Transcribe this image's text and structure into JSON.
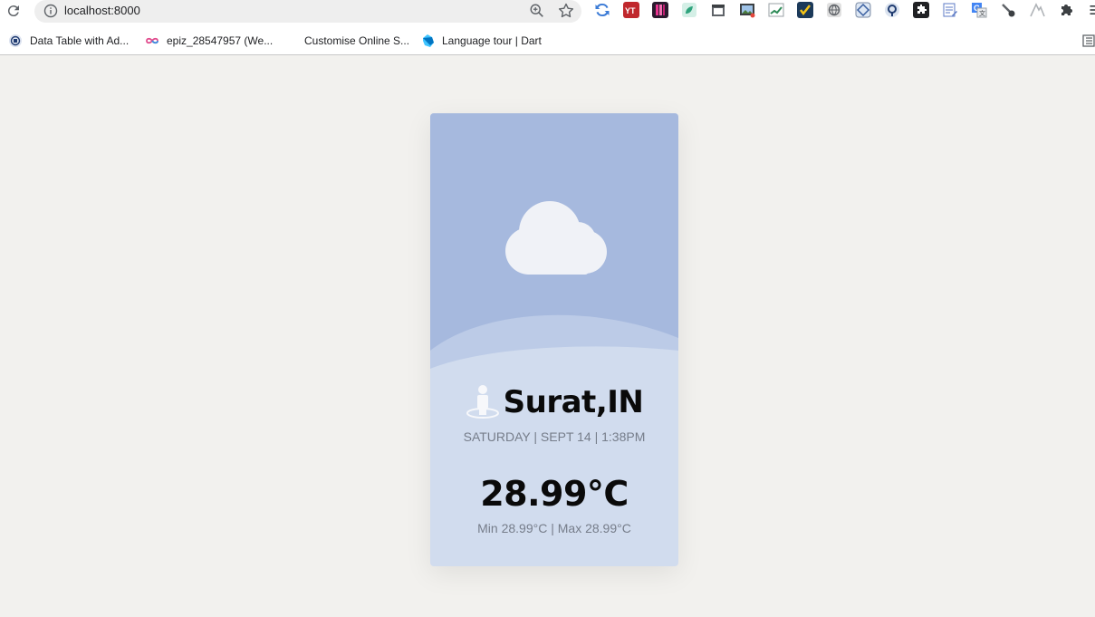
{
  "browser": {
    "url": "localhost:8000",
    "bookmarks": [
      {
        "label": "Data Table with Ad...",
        "icon": "datatables-icon"
      },
      {
        "label": "epiz_28547957 (We...",
        "icon": "infinity-icon"
      },
      {
        "label": "Customise Online S...",
        "icon": "blank-icon"
      },
      {
        "label": "Language tour | Dart",
        "icon": "dart-icon"
      }
    ],
    "extensions": [
      "sync-icon",
      "youtube-icon",
      "notebook-icon",
      "leaf-icon",
      "calendar-icon",
      "image-icon",
      "chart-icon",
      "check-icon",
      "globe-icon",
      "diamond-icon",
      "lens-icon",
      "puzzle-dark-icon",
      "edit-icon",
      "translate-icon",
      "dropper-icon",
      "mountain-icon",
      "extensions-icon",
      "menu-icon"
    ]
  },
  "weather": {
    "city": "Surat,IN",
    "datetime": "SATURDAY | SEPT 14 | 1:38PM",
    "temperature": "28.99°C",
    "minmax": "Min 28.99°C | Max 28.99°C",
    "condition_icon": "cloud-icon"
  },
  "colors": {
    "page_bg": "#f2f1ee",
    "card_top": "#a6b9de",
    "card_bottom": "#d1dcee",
    "cloud": "#f0f2f7"
  }
}
